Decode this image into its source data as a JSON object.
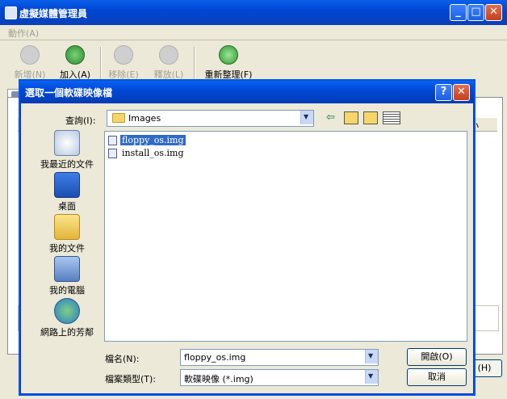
{
  "main_window": {
    "title": "虛擬媒體管理員",
    "menu": [
      "動作(A)"
    ],
    "toolbar": [
      {
        "label": "新增(N)",
        "icon": "new-disk-icon",
        "enabled": false
      },
      {
        "label": "加入(A)",
        "icon": "add-disk-icon",
        "enabled": true
      },
      {
        "label": "移除(E)",
        "icon": "remove-disk-icon",
        "enabled": false
      },
      {
        "label": "釋放(L)",
        "icon": "release-disk-icon",
        "enabled": false
      },
      {
        "label": "重新整理(F)",
        "icon": "refresh-icon",
        "enabled": true
      }
    ],
    "column_fragment": "小",
    "bottom_button_fragment": "(H)"
  },
  "dialog": {
    "title": "選取一個軟碟映像檔",
    "title_buttons": {
      "help": "?",
      "close": "✕"
    },
    "look_in_label": "查詢(I):",
    "look_in_value": "Images",
    "places": [
      {
        "label": "我最近的文件",
        "icon": "recent-documents-icon"
      },
      {
        "label": "桌面",
        "icon": "desktop-icon"
      },
      {
        "label": "我的文件",
        "icon": "my-documents-icon"
      },
      {
        "label": "我的電腦",
        "icon": "my-computer-icon"
      },
      {
        "label": "網路上的芳鄰",
        "icon": "network-places-icon"
      }
    ],
    "files": [
      {
        "name": "floppy_os.img",
        "selected": true
      },
      {
        "name": "install_os.img",
        "selected": false
      }
    ],
    "filename_label": "檔名(N):",
    "filename_value": "floppy_os.img",
    "filetype_label": "檔案類型(T):",
    "filetype_value": "軟碟映像 (*.img)",
    "open_button": "開啟(O)",
    "cancel_button": "取消"
  },
  "colors": {
    "titlebar": "#0046d5",
    "selection": "#316ac5",
    "window_bg": "#ece9d8"
  }
}
